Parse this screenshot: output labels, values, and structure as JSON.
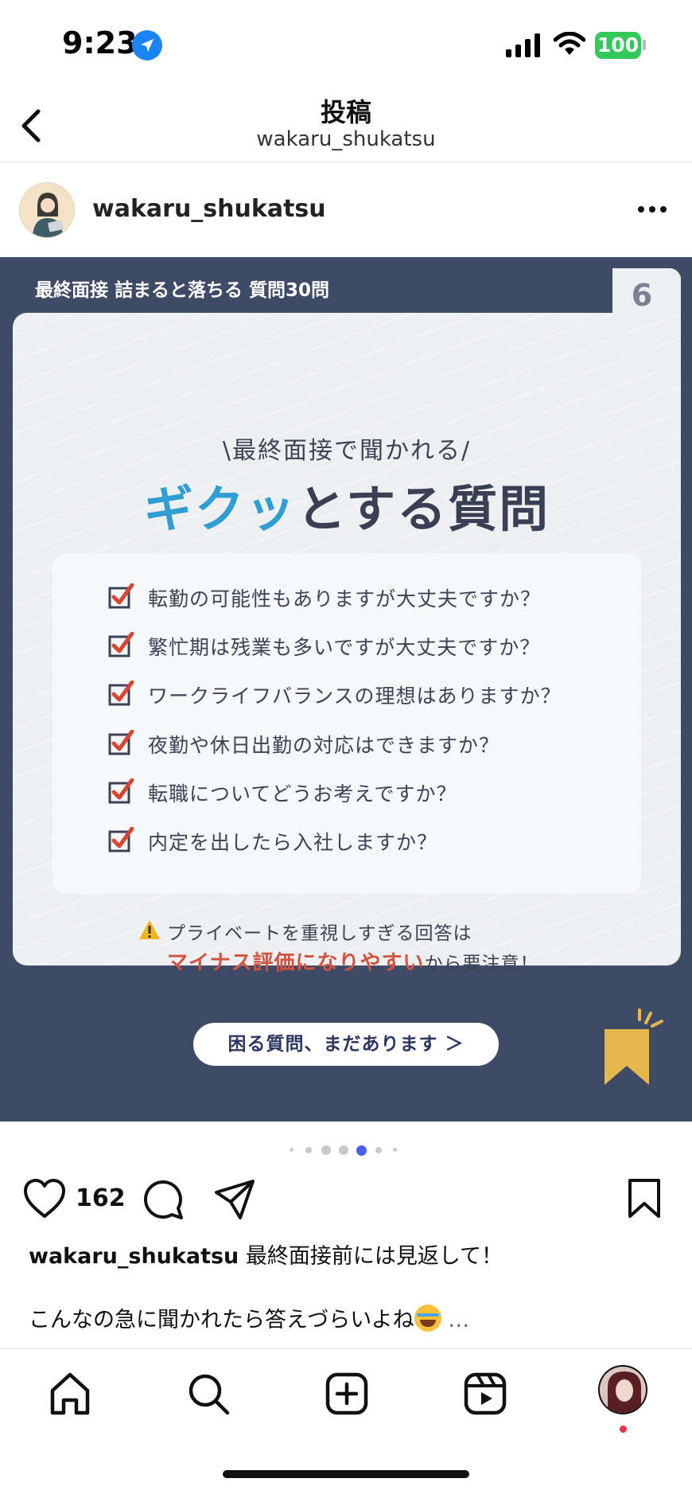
{
  "status_bar": {
    "time": "9:23",
    "battery": "100"
  },
  "nav": {
    "title": "投稿",
    "subtitle": "wakaru_shukatsu"
  },
  "post": {
    "username": "wakaru_shukatsu",
    "slide": {
      "tag": "最終面接 詰まると落ちる 質問30問",
      "page_number": "6",
      "kicker": "\\最終面接で聞かれる/",
      "title_accent": "ギクッ",
      "title_rest": "とする質問",
      "questions": [
        "転勤の可能性もありますが大丈夫ですか？",
        "繁忙期は残業も多いですが大丈夫ですか？",
        "ワークライフバランスの理想はありますか？",
        "夜勤や休日出勤の対応はできますか？",
        "転職についてどうお考えですか？",
        "内定を出したら入社しますか？"
      ],
      "warning_line1": "プライベートを重視しすぎる回答は",
      "warning_strong": "マイナス評価になりやすい",
      "warning_rest": "から要注意！",
      "cta": "困る質問、まだあります ＞"
    },
    "carousel": {
      "total": 7,
      "active_index": 4
    },
    "likes": "162",
    "caption": {
      "username": "wakaru_shukatsu",
      "text": "最終面接前には見返して！",
      "line2": "こんなの急に聞かれたら答えづらいよね",
      "more": "…"
    }
  },
  "colors": {
    "slide_bg": "#3f4a66",
    "accent_blue": "#2f9ed3",
    "warning_red": "#d05440",
    "check_red": "#d84530",
    "bookmark_gold": "#e4b84a",
    "battery_green": "#34c759",
    "dot_active": "#4a5ee8"
  },
  "tabbar": {
    "items": [
      "home-icon",
      "search-icon",
      "create-icon",
      "reels-icon",
      "profile-avatar"
    ]
  }
}
